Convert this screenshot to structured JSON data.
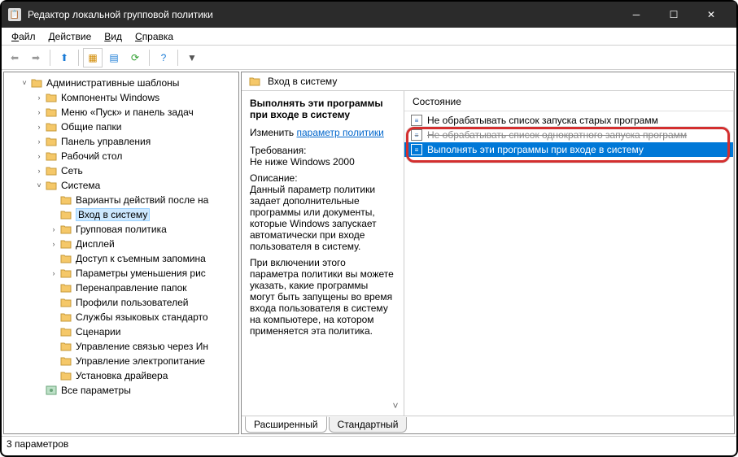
{
  "window": {
    "title": "Редактор локальной групповой политики"
  },
  "menu": {
    "file": "Файл",
    "action": "Действие",
    "view": "Вид",
    "help": "Справка"
  },
  "tree": {
    "root": "Административные шаблоны",
    "items": [
      "Компоненты Windows",
      "Меню «Пуск» и панель задач",
      "Общие папки",
      "Панель управления",
      "Рабочий стол",
      "Сеть"
    ],
    "system": "Система",
    "system_items": [
      "Варианты действий после на",
      "Вход в систему",
      "Групповая политика",
      "Дисплей",
      "Доступ к съемным запомина",
      "Параметры уменьшения рис",
      "Перенаправление папок",
      "Профили пользователей",
      "Службы языковых стандарто",
      "Сценарии",
      "Управление связью через Ин",
      "Управление электропитание",
      "Установка драйвера"
    ],
    "all": "Все параметры"
  },
  "right": {
    "title": "Вход в систему",
    "policy_name": "Выполнять эти программы при входе в систему",
    "edit_label": "Изменить",
    "edit_link": "параметр политики",
    "req_label": "Требования:",
    "req_value": "Не ниже Windows 2000",
    "desc_label": "Описание:",
    "desc1": "Данный параметр политики задает дополнительные программы или документы, которые Windows запускает автоматически при входе пользователя в систему.",
    "desc2": "При включении этого параметра политики вы можете указать, какие программы могут быть запущены во время входа пользователя в систему на компьютере, на котором применяется эта политика.",
    "state_label": "Состояние",
    "items": [
      "Не обрабатывать список запуска старых программ",
      "Не обрабатывать список однократного запуска программ",
      "Выполнять эти программы при входе в систему"
    ],
    "tabs": {
      "extended": "Расширенный",
      "standard": "Стандартный"
    }
  },
  "status": "3 параметров"
}
